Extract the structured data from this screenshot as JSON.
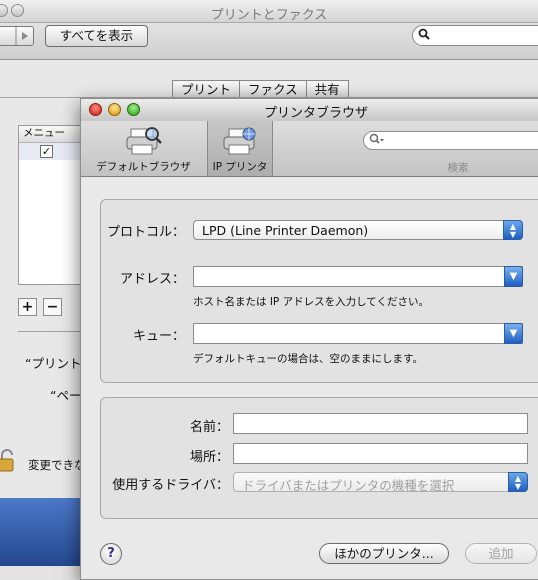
{
  "background_window": {
    "title": "プリントとファクス",
    "show_all_label": "すべてを表示",
    "tabs": [
      "プリント",
      "ファクス",
      "共有"
    ],
    "list_header": "メニュー",
    "list_checked": "✓",
    "plus_label": "+",
    "minus_label": "−",
    "default_printer_label": "“プリント",
    "page_setup_label": "“ペー",
    "lock_text": "変更できな"
  },
  "window": {
    "title": "プリンタブラウザ",
    "toolbar": {
      "default_browser_label": "デフォルトブラウザ",
      "ip_printer_label": "IP プリンタ",
      "search_label": "検索",
      "search_placeholder": ""
    },
    "protocol": {
      "label": "プロトコル：",
      "value": "LPD (Line Printer Daemon)"
    },
    "address": {
      "label": "アドレス：",
      "value": "",
      "hint": "ホスト名または IP アドレスを入力してください。"
    },
    "queue": {
      "label": "キュー：",
      "value": "",
      "hint": "デフォルトキューの場合は、空のままにします。"
    },
    "name": {
      "label": "名前：",
      "value": ""
    },
    "location": {
      "label": "場所：",
      "value": ""
    },
    "driver": {
      "label": "使用するドライバ：",
      "value": "ドライバまたはプリンタの機種を選択"
    },
    "help_label": "?",
    "other_printers_button": "ほかのプリンタ...",
    "add_button": "追加"
  },
  "colors": {
    "accent_blue": "#1f5fc4",
    "close": "#c9140a",
    "minimize": "#d99000",
    "zoom": "#2c9b12"
  }
}
